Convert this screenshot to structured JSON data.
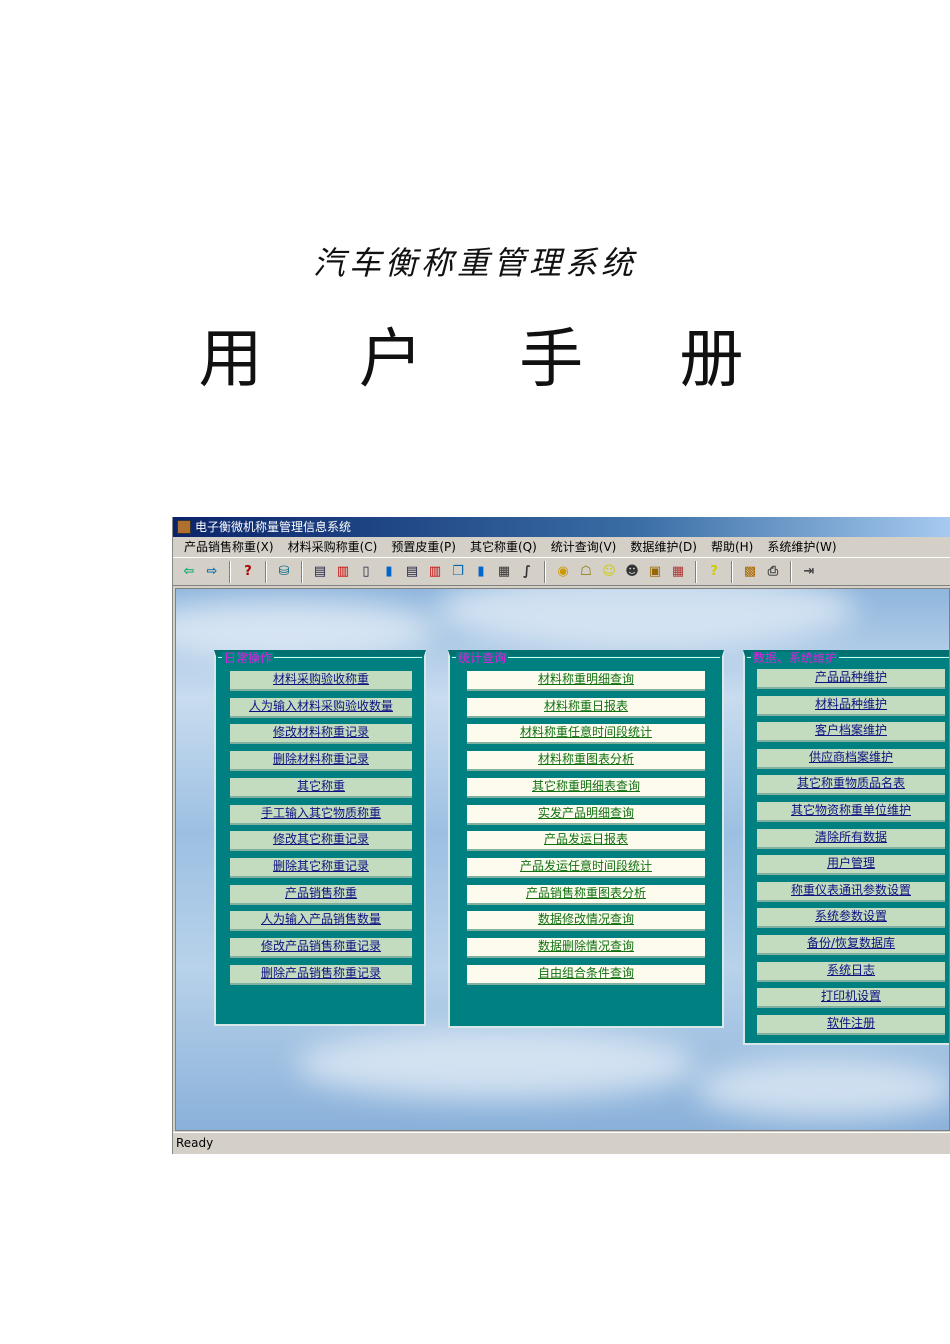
{
  "doc": {
    "subtitle": "汽车衡称重管理系统",
    "title": "用 户 手 册"
  },
  "window": {
    "title": "电子衡微机称量管理信息系统",
    "menu": [
      "产品销售称重(X)",
      "材料采购称重(C)",
      "预置皮重(P)",
      "其它称重(Q)",
      "统计查询(V)",
      "数据维护(D)",
      "帮助(H)",
      "系统维护(W)"
    ],
    "toolbar_icons": [
      "login-icon",
      "logout-icon",
      "help-query-icon",
      "database-icon",
      "report-icon",
      "chart-table-icon",
      "columns-icon",
      "bar-chart-icon",
      "report2-icon",
      "chart-table2-icon",
      "copy-icon",
      "bar-chart2-icon",
      "calculator-icon",
      "formula-icon",
      "coins-icon",
      "tree-icon",
      "smiley-icon",
      "user-icon",
      "box-icon",
      "grid-icon",
      "question-icon",
      "contacts-icon",
      "print-icon",
      "exit-icon"
    ],
    "status": "Ready"
  },
  "panels": [
    {
      "legend": "日常操作",
      "items": [
        "材料采购验收称重",
        "人为输入材料采购验收数量",
        "修改材料称重记录",
        "删除材料称重记录",
        "其它称重",
        "手工输入其它物质称重",
        "修改其它称重记录",
        "删除其它称重记录",
        "产品销售称重",
        "人为输入产品销售数量",
        "修改产品销售称重记录",
        "删除产品销售称重记录"
      ]
    },
    {
      "legend": "统计查询",
      "items": [
        "材料称重明细查询",
        "材料称重日报表",
        "材料称重任意时间段统计",
        "材料称重图表分析",
        "其它称重明细表查询",
        "实发产品明细查询",
        "产品发运日报表",
        "产品发运任意时间段统计",
        "产品销售称重图表分析",
        "数据修改情况查询",
        "数据删除情况查询",
        "自由组合条件查询"
      ]
    },
    {
      "legend": "数据、系统维护",
      "items": [
        "产品品种维护",
        "材料品种维护",
        "客户档案维护",
        "供应商档案维护",
        "其它称重物质品名表",
        "其它物资称重单位维护",
        "清除所有数据",
        "用户管理",
        "称重仪表通讯参数设置",
        "系统参数设置",
        "备份/恢复数据库",
        "系统日志",
        "打印机设置",
        "软件注册"
      ]
    }
  ]
}
